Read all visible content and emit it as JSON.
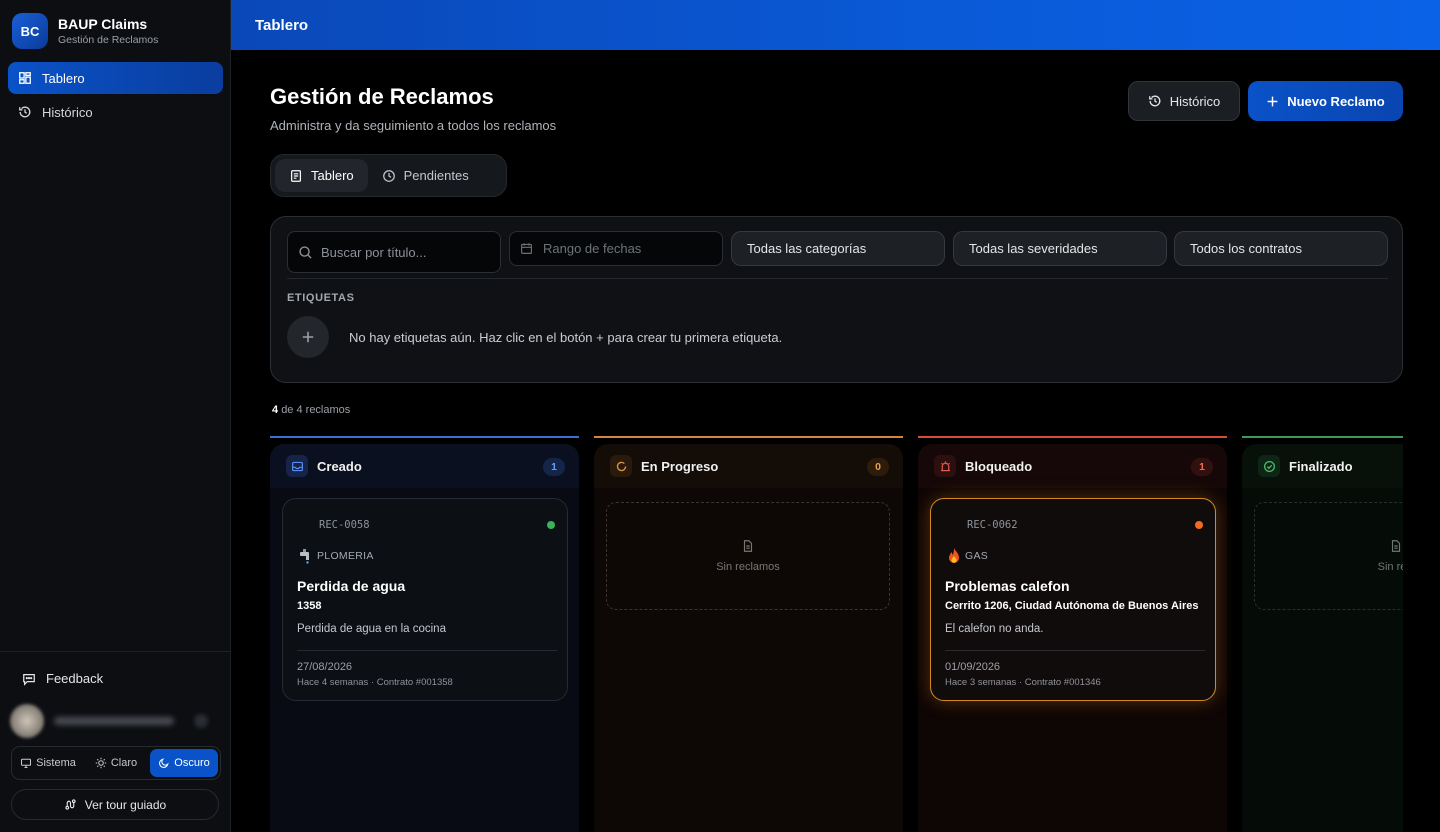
{
  "app": {
    "logo": "BC",
    "name": "BAUP Claims",
    "subtitle": "Gestión de Reclamos"
  },
  "sidebar": {
    "items": [
      {
        "label": "Tablero",
        "icon": "grid-icon",
        "active": true
      },
      {
        "label": "Histórico",
        "icon": "history-icon",
        "active": false
      }
    ],
    "feedback": "Feedback",
    "theme": {
      "options": [
        "Sistema",
        "Claro",
        "Oscuro"
      ],
      "selected": "Oscuro"
    },
    "tour": "Ver tour guiado"
  },
  "header": {
    "title": "Tablero"
  },
  "main": {
    "title": "Gestión de Reclamos",
    "subtitle": "Administra y da seguimiento a todos los reclamos",
    "history_button": "Histórico",
    "new_button": "Nuevo Reclamo",
    "tabs": [
      {
        "label": "Tablero",
        "active": true
      },
      {
        "label": "Pendientes",
        "active": false
      }
    ]
  },
  "filters": {
    "search_placeholder": "Buscar por título...",
    "date_placeholder": "Rango de fechas",
    "category": "Todas las categorías",
    "severity": "Todas las severidades",
    "contract": "Todos los contratos",
    "tags_label": "ETIQUETAS",
    "tags_empty": "No hay etiquetas aún. Haz clic en el botón + para crear tu primera etiqueta."
  },
  "summary": {
    "shown": "4",
    "rest": "de 4 reclamos"
  },
  "columns": [
    {
      "name": "Creado",
      "count": "1",
      "color": "#3b6fd6"
    },
    {
      "name": "En Progreso",
      "count": "0",
      "color": "#d6843b",
      "empty": "Sin reclamos"
    },
    {
      "name": "Bloqueado",
      "count": "1",
      "color": "#d64b3b"
    },
    {
      "name": "Finalizado",
      "count": "",
      "color": "#3b9a55",
      "empty": "Sin recl"
    }
  ],
  "cards": [
    {
      "id": "REC-0058",
      "category": "PLOMERIA",
      "category_icon": "faucet-icon",
      "title": "Perdida de agua",
      "address": "1358",
      "description": "Perdida de agua en la cocina",
      "date": "27/08/2026",
      "meta": "Hace 4 semanas · Contrato #001358",
      "dot_color": "#3bb15a"
    },
    {
      "id": "REC-0062",
      "category": "GAS",
      "category_icon": "fire-icon",
      "title": "Problemas calefon",
      "address": "Cerrito 1206, Ciudad Autónoma de Buenos Aires",
      "description": "El calefon no anda.",
      "date": "01/09/2026",
      "meta": "Hace 3 semanas · Contrato #001346",
      "dot_color": "#f26b1d"
    }
  ]
}
